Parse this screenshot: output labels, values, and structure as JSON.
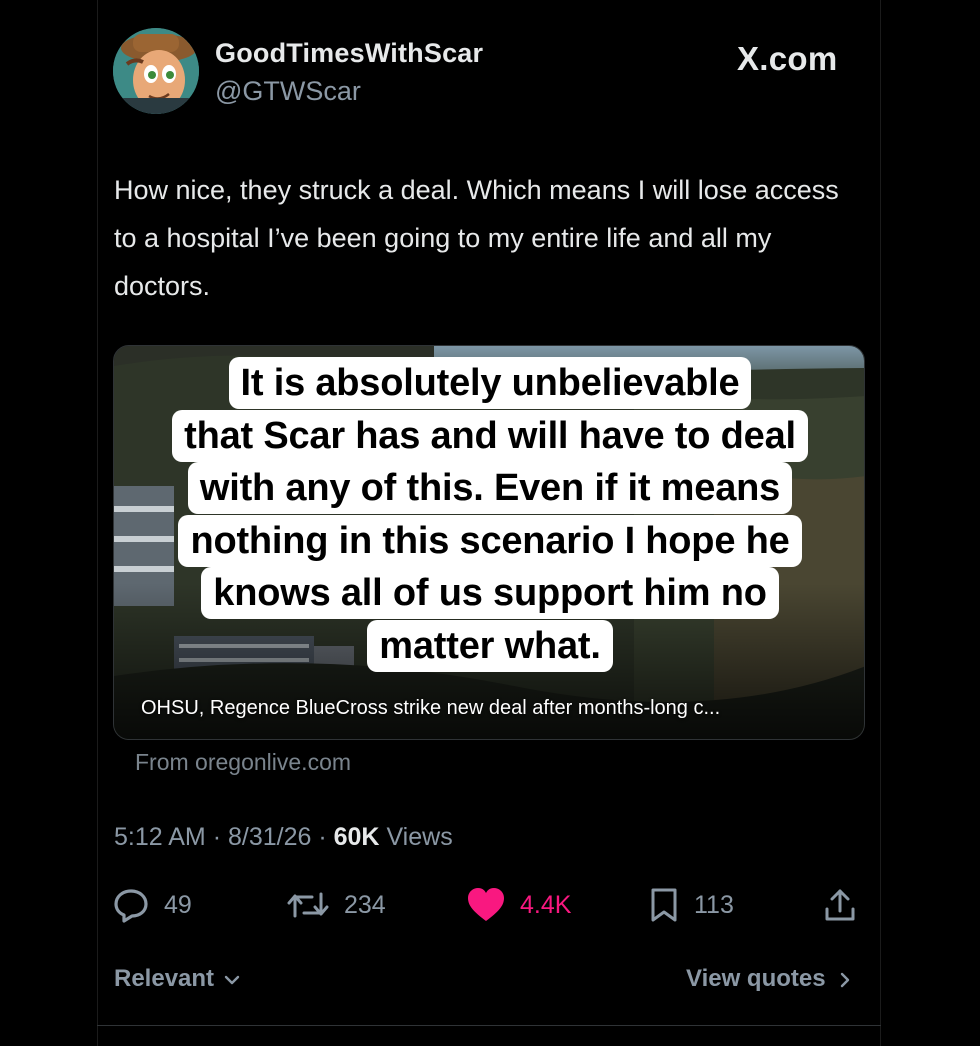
{
  "author": {
    "display_name": "GoodTimesWithScar",
    "handle": "@GTWScar"
  },
  "brand": "X.com",
  "tweet": {
    "text": "How nice, they struck a deal. Which means I will lose access to a hospital I’ve been going to my entire life and all my doctors."
  },
  "link_card": {
    "headline": "OHSU, Regence BlueCross strike new deal after months-long c...",
    "source": "From oregonlive.com"
  },
  "overlay_caption": {
    "lines": [
      "It is absolutely unbelievable",
      "that Scar has and will have to deal",
      "with any of this. Even if it means",
      "nothing in this scenario I hope he",
      "knows all of us support him no",
      "matter what."
    ]
  },
  "meta": {
    "time": "5:12 AM",
    "date": "8/31/26",
    "views_count": "60K",
    "views_label": "Views"
  },
  "actions": {
    "replies": "49",
    "reposts": "234",
    "likes": "4.4K",
    "bookmarks": "113"
  },
  "footer": {
    "sort_label": "Relevant",
    "view_quotes": "View quotes"
  },
  "colors": {
    "background": "#000000",
    "like_pink": "#f91880",
    "muted": "#8b98a5"
  },
  "icons": [
    "reply-icon",
    "repost-icon",
    "heart-icon",
    "bookmark-icon",
    "share-icon",
    "chevron-down-icon",
    "chevron-right-icon"
  ]
}
